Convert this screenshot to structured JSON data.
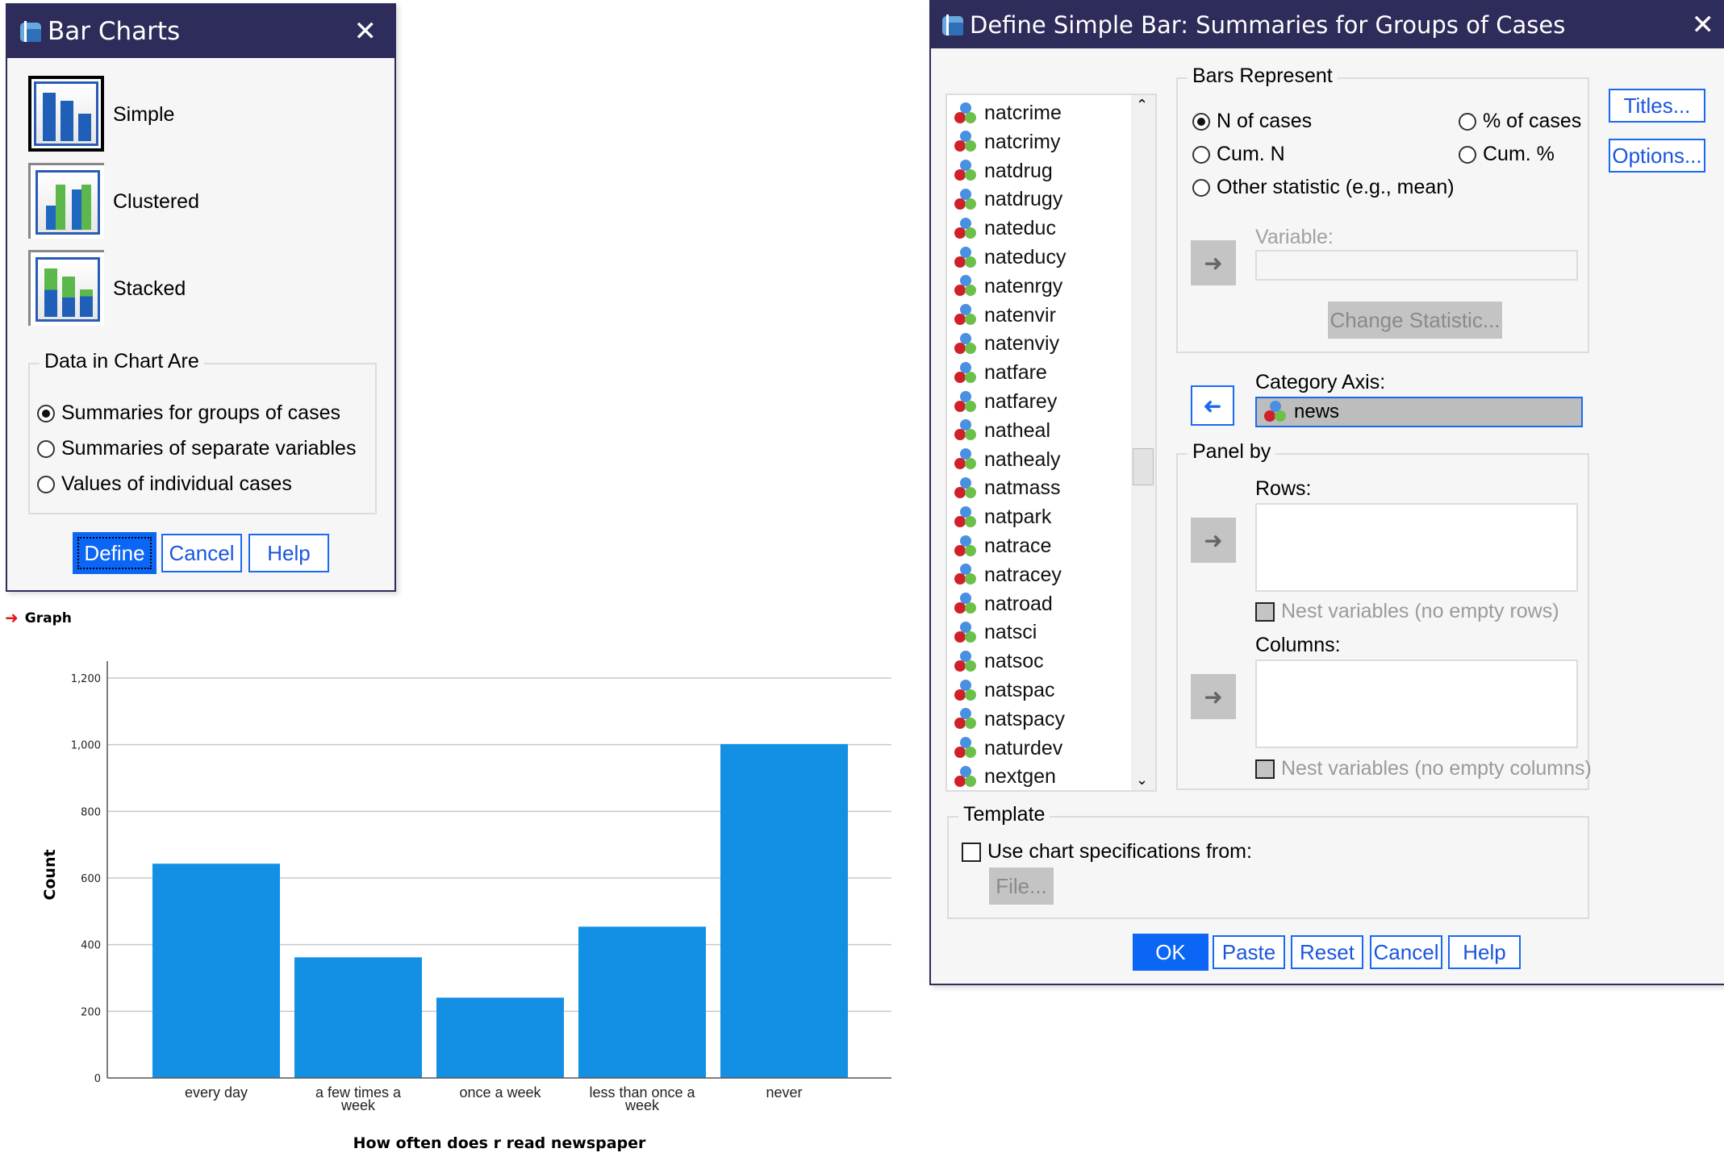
{
  "bar_charts_dialog": {
    "title": "Bar Charts",
    "chart_types": [
      {
        "label": "Simple",
        "selected": true
      },
      {
        "label": "Clustered",
        "selected": false
      },
      {
        "label": "Stacked",
        "selected": false
      }
    ],
    "data_group_label": "Data in Chart Are",
    "data_options": [
      {
        "label": "Summaries for groups of cases",
        "checked": true
      },
      {
        "label": "Summaries of separate variables",
        "checked": false
      },
      {
        "label": "Values of individual cases",
        "checked": false
      }
    ],
    "buttons": {
      "define": "Define",
      "cancel": "Cancel",
      "help": "Help"
    }
  },
  "define_dialog": {
    "title": "Define Simple Bar: Summaries for Groups of Cases",
    "variables": [
      "natcrime",
      "natcrimy",
      "natdrug",
      "natdrugy",
      "nateduc",
      "nateducy",
      "natenrgy",
      "natenvir",
      "natenviy",
      "natfare",
      "natfarey",
      "natheal",
      "nathealy",
      "natmass",
      "natpark",
      "natrace",
      "natracey",
      "natroad",
      "natsci",
      "natsoc",
      "natspac",
      "natspacy",
      "naturdev",
      "nextgen"
    ],
    "bars_represent": {
      "label": "Bars Represent",
      "options": [
        {
          "label": "N of cases",
          "checked": true
        },
        {
          "label": "% of cases",
          "checked": false
        },
        {
          "label": "Cum. N",
          "checked": false
        },
        {
          "label": "Cum. %",
          "checked": false
        },
        {
          "label": "Other statistic (e.g., mean)",
          "checked": false
        }
      ],
      "variable_label": "Variable:",
      "variable_value": "",
      "change_statistic": "Change Statistic..."
    },
    "category_axis": {
      "label": "Category Axis:",
      "value": "news"
    },
    "panel_by": {
      "label": "Panel by",
      "rows_label": "Rows:",
      "nest_rows": "Nest variables (no empty rows)",
      "columns_label": "Columns:",
      "nest_columns": "Nest variables (no empty columns)"
    },
    "template": {
      "label": "Template",
      "use_spec": "Use chart specifications from:",
      "file_button": "File..."
    },
    "side_buttons": {
      "titles": "Titles...",
      "options": "Options..."
    },
    "buttons": {
      "ok": "OK",
      "paste": "Paste",
      "reset": "Reset",
      "cancel": "Cancel",
      "help": "Help"
    }
  },
  "output": {
    "graph_label": "Graph"
  },
  "chart_data": {
    "type": "bar",
    "categories": [
      "every day",
      "a few times a week",
      "once a week",
      "less than once a week",
      "never"
    ],
    "category_lines": [
      [
        "every day"
      ],
      [
        "a few times a",
        "week"
      ],
      [
        "once a week"
      ],
      [
        "less than once a",
        "week"
      ],
      [
        "never"
      ]
    ],
    "values": [
      643,
      362,
      241,
      454,
      1002
    ],
    "title": "",
    "xlabel": "How often does r read newspaper",
    "ylabel": "Count",
    "ylim": [
      0,
      1200
    ],
    "yticks": [
      0,
      200,
      400,
      600,
      800,
      1000,
      1200
    ],
    "ytick_labels": [
      "0",
      "200",
      "400",
      "600",
      "800",
      "1,000",
      "1,200"
    ],
    "grid": true,
    "bar_color": "#1390e4"
  }
}
